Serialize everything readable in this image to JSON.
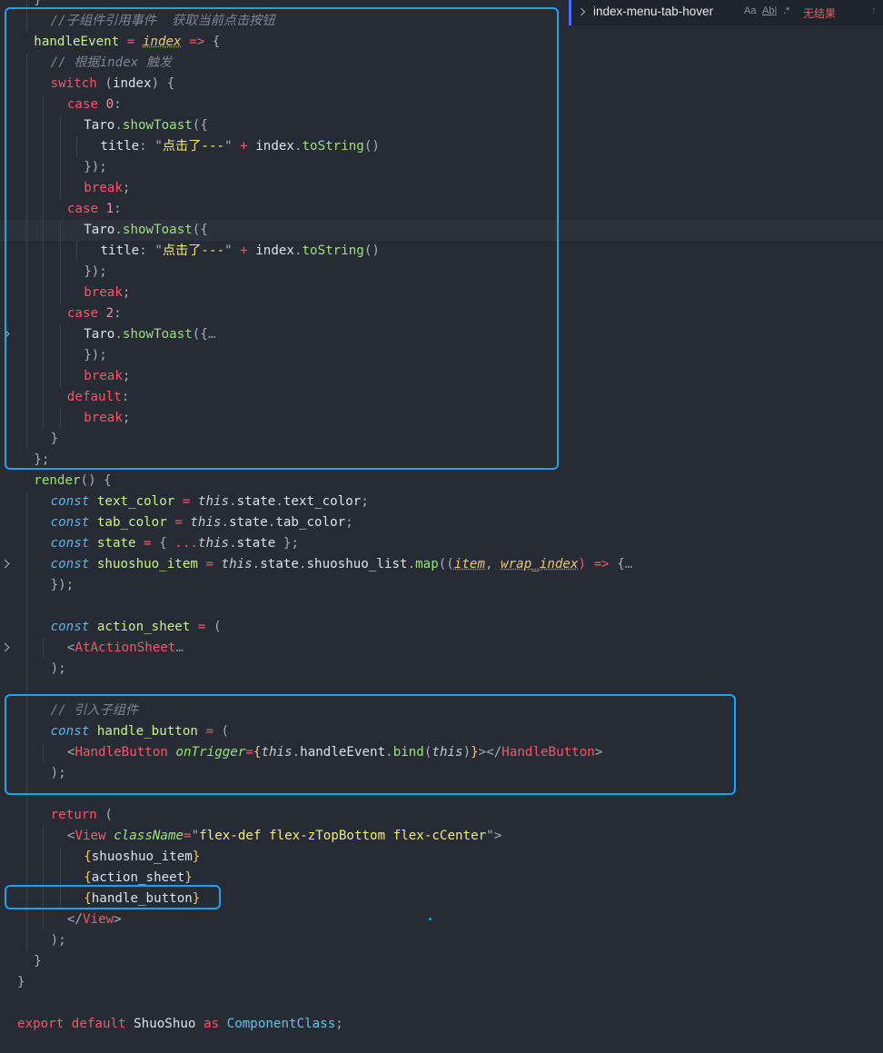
{
  "find_widget": {
    "query": "index-menu-tab-hover",
    "match_case": "Aa",
    "whole_word": "Ab|",
    "regex": ".*",
    "result": "无结果",
    "prev_arrow": "↑"
  },
  "lines": [
    {
      "indent": 1,
      "guides": [
        1
      ],
      "tokens": [
        {
          "t": "}",
          "c": "punct"
        }
      ]
    },
    {
      "indent": 2,
      "guides": [
        1
      ],
      "tokens": [
        {
          "t": "//子组件引用事件  获取当前点击按钮",
          "c": "comment"
        }
      ]
    },
    {
      "indent": 1,
      "guides": [],
      "tokens": [
        {
          "t": "handleEvent",
          "c": "var"
        },
        {
          "t": " = ",
          "c": "op"
        },
        {
          "t": "index",
          "c": "param"
        },
        {
          "t": " => ",
          "c": "op"
        },
        {
          "t": "{",
          "c": "punct"
        }
      ]
    },
    {
      "indent": 2,
      "guides": [
        1
      ],
      "tokens": [
        {
          "t": "// 根据index 触发",
          "c": "comment"
        }
      ]
    },
    {
      "indent": 2,
      "guides": [
        1
      ],
      "tokens": [
        {
          "t": "switch",
          "c": "kw"
        },
        {
          "t": " (",
          "c": "punct"
        },
        {
          "t": "index",
          "c": "plain"
        },
        {
          "t": ") {",
          "c": "punct"
        }
      ]
    },
    {
      "indent": 3,
      "guides": [
        1,
        2
      ],
      "tokens": [
        {
          "t": "case",
          "c": "kw"
        },
        {
          "t": " ",
          "c": "plain"
        },
        {
          "t": "0",
          "c": "num"
        },
        {
          "t": ":",
          "c": "punct"
        }
      ]
    },
    {
      "indent": 4,
      "guides": [
        1,
        2,
        3
      ],
      "tokens": [
        {
          "t": "Taro",
          "c": "plain"
        },
        {
          "t": ".",
          "c": "punct"
        },
        {
          "t": "showToast",
          "c": "fn"
        },
        {
          "t": "({",
          "c": "punct"
        }
      ]
    },
    {
      "indent": 5,
      "guides": [
        1,
        2,
        3,
        4
      ],
      "tokens": [
        {
          "t": "title",
          "c": "prop"
        },
        {
          "t": ": ",
          "c": "punct"
        },
        {
          "t": "\"",
          "c": "punct"
        },
        {
          "t": "点击了---",
          "c": "str"
        },
        {
          "t": "\"",
          "c": "punct"
        },
        {
          "t": " + ",
          "c": "op"
        },
        {
          "t": "index",
          "c": "plain"
        },
        {
          "t": ".",
          "c": "punct"
        },
        {
          "t": "toString",
          "c": "fn"
        },
        {
          "t": "()",
          "c": "punct"
        }
      ]
    },
    {
      "indent": 4,
      "guides": [
        1,
        2,
        3
      ],
      "tokens": [
        {
          "t": "});",
          "c": "punct"
        }
      ]
    },
    {
      "indent": 4,
      "guides": [
        1,
        2,
        3
      ],
      "tokens": [
        {
          "t": "break",
          "c": "kw"
        },
        {
          "t": ";",
          "c": "punct"
        }
      ]
    },
    {
      "indent": 3,
      "guides": [
        1,
        2
      ],
      "tokens": [
        {
          "t": "case",
          "c": "kw"
        },
        {
          "t": " ",
          "c": "plain"
        },
        {
          "t": "1",
          "c": "num"
        },
        {
          "t": ":",
          "c": "punct"
        }
      ]
    },
    {
      "indent": 4,
      "guides": [
        1,
        2,
        3
      ],
      "active": true,
      "tokens": [
        {
          "t": "Taro",
          "c": "plain"
        },
        {
          "t": ".",
          "c": "punct"
        },
        {
          "t": "showToast",
          "c": "fn"
        },
        {
          "t": "({",
          "c": "punct"
        }
      ]
    },
    {
      "indent": 5,
      "guides": [
        1,
        2,
        3,
        4
      ],
      "tokens": [
        {
          "t": "title",
          "c": "prop"
        },
        {
          "t": ": ",
          "c": "punct"
        },
        {
          "t": "\"",
          "c": "punct"
        },
        {
          "t": "点击了---",
          "c": "str"
        },
        {
          "t": "\"",
          "c": "punct"
        },
        {
          "t": " + ",
          "c": "op"
        },
        {
          "t": "index",
          "c": "plain"
        },
        {
          "t": ".",
          "c": "punct"
        },
        {
          "t": "toString",
          "c": "fn"
        },
        {
          "t": "()",
          "c": "punct"
        }
      ]
    },
    {
      "indent": 4,
      "guides": [
        1,
        2,
        3
      ],
      "tokens": [
        {
          "t": "});",
          "c": "punct"
        }
      ]
    },
    {
      "indent": 4,
      "guides": [
        1,
        2,
        3
      ],
      "tokens": [
        {
          "t": "break",
          "c": "kw"
        },
        {
          "t": ";",
          "c": "punct"
        }
      ]
    },
    {
      "indent": 3,
      "guides": [
        1,
        2
      ],
      "tokens": [
        {
          "t": "case",
          "c": "kw"
        },
        {
          "t": " ",
          "c": "plain"
        },
        {
          "t": "2",
          "c": "num"
        },
        {
          "t": ":",
          "c": "punct"
        }
      ]
    },
    {
      "indent": 4,
      "guides": [
        1,
        2,
        3
      ],
      "fold": true,
      "tokens": [
        {
          "t": "Taro",
          "c": "plain"
        },
        {
          "t": ".",
          "c": "punct"
        },
        {
          "t": "showToast",
          "c": "fn"
        },
        {
          "t": "({",
          "c": "punct"
        },
        {
          "t": "…",
          "c": "ell"
        }
      ]
    },
    {
      "indent": 4,
      "guides": [
        1,
        2,
        3
      ],
      "tokens": [
        {
          "t": "});",
          "c": "punct"
        }
      ]
    },
    {
      "indent": 4,
      "guides": [
        1,
        2,
        3
      ],
      "tokens": [
        {
          "t": "break",
          "c": "kw"
        },
        {
          "t": ";",
          "c": "punct"
        }
      ]
    },
    {
      "indent": 3,
      "guides": [
        1,
        2
      ],
      "tokens": [
        {
          "t": "default",
          "c": "kw"
        },
        {
          "t": ":",
          "c": "punct"
        }
      ]
    },
    {
      "indent": 4,
      "guides": [
        1,
        2,
        3
      ],
      "tokens": [
        {
          "t": "break",
          "c": "kw"
        },
        {
          "t": ";",
          "c": "punct"
        }
      ]
    },
    {
      "indent": 2,
      "guides": [
        1
      ],
      "tokens": [
        {
          "t": "}",
          "c": "punct"
        }
      ]
    },
    {
      "indent": 1,
      "guides": [],
      "tokens": [
        {
          "t": "};",
          "c": "punct"
        }
      ]
    },
    {
      "indent": 1,
      "guides": [],
      "tokens": [
        {
          "t": "render",
          "c": "fn"
        },
        {
          "t": "() {",
          "c": "punct"
        }
      ]
    },
    {
      "indent": 2,
      "guides": [
        1
      ],
      "tokens": [
        {
          "t": "const",
          "c": "storage"
        },
        {
          "t": " ",
          "c": "plain"
        },
        {
          "t": "text_color",
          "c": "var"
        },
        {
          "t": " = ",
          "c": "op"
        },
        {
          "t": "this",
          "c": "this"
        },
        {
          "t": ".",
          "c": "punct"
        },
        {
          "t": "state",
          "c": "plain"
        },
        {
          "t": ".",
          "c": "punct"
        },
        {
          "t": "text_color",
          "c": "plain"
        },
        {
          "t": ";",
          "c": "punct"
        }
      ]
    },
    {
      "indent": 2,
      "guides": [
        1
      ],
      "tokens": [
        {
          "t": "const",
          "c": "storage"
        },
        {
          "t": " ",
          "c": "plain"
        },
        {
          "t": "tab_color",
          "c": "var"
        },
        {
          "t": " = ",
          "c": "op"
        },
        {
          "t": "this",
          "c": "this"
        },
        {
          "t": ".",
          "c": "punct"
        },
        {
          "t": "state",
          "c": "plain"
        },
        {
          "t": ".",
          "c": "punct"
        },
        {
          "t": "tab_color",
          "c": "plain"
        },
        {
          "t": ";",
          "c": "punct"
        }
      ]
    },
    {
      "indent": 2,
      "guides": [
        1
      ],
      "tokens": [
        {
          "t": "const",
          "c": "storage"
        },
        {
          "t": " ",
          "c": "plain"
        },
        {
          "t": "state",
          "c": "var"
        },
        {
          "t": " = ",
          "c": "op"
        },
        {
          "t": "{ ",
          "c": "punct"
        },
        {
          "t": "...",
          "c": "op"
        },
        {
          "t": "this",
          "c": "this"
        },
        {
          "t": ".",
          "c": "punct"
        },
        {
          "t": "state",
          "c": "plain"
        },
        {
          "t": " };",
          "c": "punct"
        }
      ]
    },
    {
      "indent": 2,
      "guides": [
        1
      ],
      "fold": true,
      "tokens": [
        {
          "t": "const",
          "c": "storage"
        },
        {
          "t": " ",
          "c": "plain"
        },
        {
          "t": "shuoshuo_item",
          "c": "var"
        },
        {
          "t": " = ",
          "c": "op"
        },
        {
          "t": "this",
          "c": "this"
        },
        {
          "t": ".",
          "c": "punct"
        },
        {
          "t": "state",
          "c": "plain"
        },
        {
          "t": ".",
          "c": "punct"
        },
        {
          "t": "shuoshuo_list",
          "c": "plain"
        },
        {
          "t": ".",
          "c": "punct"
        },
        {
          "t": "map",
          "c": "fn"
        },
        {
          "t": "((",
          "c": "punct"
        },
        {
          "t": "item",
          "c": "param"
        },
        {
          "t": ", ",
          "c": "punct"
        },
        {
          "t": "wrap_index",
          "c": "param"
        },
        {
          "t": ") => ",
          "c": "op"
        },
        {
          "t": "{",
          "c": "punct"
        },
        {
          "t": "…",
          "c": "ell"
        }
      ]
    },
    {
      "indent": 2,
      "guides": [
        1
      ],
      "tokens": [
        {
          "t": "});",
          "c": "punct"
        }
      ]
    },
    {
      "indent": 0,
      "guides": [
        1
      ],
      "tokens": []
    },
    {
      "indent": 2,
      "guides": [
        1
      ],
      "tokens": [
        {
          "t": "const",
          "c": "storage"
        },
        {
          "t": " ",
          "c": "plain"
        },
        {
          "t": "action_sheet",
          "c": "var"
        },
        {
          "t": " = ",
          "c": "op"
        },
        {
          "t": "(",
          "c": "punct"
        }
      ]
    },
    {
      "indent": 3,
      "guides": [
        1,
        2
      ],
      "fold": true,
      "tokens": [
        {
          "t": "<",
          "c": "punct"
        },
        {
          "t": "AtActionSheet",
          "c": "tag"
        },
        {
          "t": "…",
          "c": "ell"
        }
      ]
    },
    {
      "indent": 2,
      "guides": [
        1
      ],
      "tokens": [
        {
          "t": ");",
          "c": "punct"
        }
      ]
    },
    {
      "indent": 0,
      "guides": [
        1
      ],
      "tokens": []
    },
    {
      "indent": 2,
      "guides": [
        1
      ],
      "tokens": [
        {
          "t": "// 引入子组件",
          "c": "comment"
        }
      ]
    },
    {
      "indent": 2,
      "guides": [
        1
      ],
      "tokens": [
        {
          "t": "const",
          "c": "storage"
        },
        {
          "t": " ",
          "c": "plain"
        },
        {
          "t": "handle_button",
          "c": "var"
        },
        {
          "t": " = ",
          "c": "op"
        },
        {
          "t": "(",
          "c": "punct"
        }
      ]
    },
    {
      "indent": 3,
      "guides": [
        1,
        2
      ],
      "tokens": [
        {
          "t": "<",
          "c": "punct"
        },
        {
          "t": "HandleButton",
          "c": "tag"
        },
        {
          "t": " ",
          "c": "plain"
        },
        {
          "t": "onTrigger",
          "c": "attr"
        },
        {
          "t": "=",
          "c": "op"
        },
        {
          "t": "{",
          "c": "brace"
        },
        {
          "t": "this",
          "c": "this"
        },
        {
          "t": ".",
          "c": "punct"
        },
        {
          "t": "handleEvent",
          "c": "plain"
        },
        {
          "t": ".",
          "c": "punct"
        },
        {
          "t": "bind",
          "c": "fn"
        },
        {
          "t": "(",
          "c": "punct"
        },
        {
          "t": "this",
          "c": "this"
        },
        {
          "t": ")",
          "c": "punct"
        },
        {
          "t": "}",
          "c": "brace"
        },
        {
          "t": "></",
          "c": "punct"
        },
        {
          "t": "HandleButton",
          "c": "tag"
        },
        {
          "t": ">",
          "c": "punct"
        }
      ]
    },
    {
      "indent": 2,
      "guides": [
        1
      ],
      "tokens": [
        {
          "t": ");",
          "c": "punct"
        }
      ]
    },
    {
      "indent": 0,
      "guides": [
        1
      ],
      "tokens": []
    },
    {
      "indent": 2,
      "guides": [
        1
      ],
      "tokens": [
        {
          "t": "return",
          "c": "kw"
        },
        {
          "t": " (",
          "c": "punct"
        }
      ]
    },
    {
      "indent": 3,
      "guides": [
        1,
        2
      ],
      "tokens": [
        {
          "t": "<",
          "c": "punct"
        },
        {
          "t": "View",
          "c": "tag"
        },
        {
          "t": " ",
          "c": "plain"
        },
        {
          "t": "className",
          "c": "attr"
        },
        {
          "t": "=",
          "c": "op"
        },
        {
          "t": "\"",
          "c": "punct"
        },
        {
          "t": "flex-def flex-zTopBottom flex-cCenter",
          "c": "str"
        },
        {
          "t": "\">",
          "c": "punct"
        }
      ]
    },
    {
      "indent": 4,
      "guides": [
        1,
        2,
        3
      ],
      "tokens": [
        {
          "t": "{",
          "c": "brace"
        },
        {
          "t": "shuoshuo_item",
          "c": "plain"
        },
        {
          "t": "}",
          "c": "brace"
        }
      ]
    },
    {
      "indent": 4,
      "guides": [
        1,
        2,
        3
      ],
      "tokens": [
        {
          "t": "{",
          "c": "brace"
        },
        {
          "t": "action_sheet",
          "c": "plain"
        },
        {
          "t": "}",
          "c": "brace"
        }
      ]
    },
    {
      "indent": 4,
      "guides": [
        1,
        2,
        3
      ],
      "tokens": [
        {
          "t": "{",
          "c": "brace"
        },
        {
          "t": "handle_button",
          "c": "plain"
        },
        {
          "t": "}",
          "c": "brace"
        }
      ]
    },
    {
      "indent": 3,
      "guides": [
        1,
        2
      ],
      "tokens": [
        {
          "t": "</",
          "c": "punct"
        },
        {
          "t": "View",
          "c": "tag"
        },
        {
          "t": ">",
          "c": "punct"
        }
      ]
    },
    {
      "indent": 2,
      "guides": [
        1
      ],
      "tokens": [
        {
          "t": ");",
          "c": "punct"
        }
      ]
    },
    {
      "indent": 1,
      "guides": [],
      "tokens": [
        {
          "t": "}",
          "c": "punct"
        }
      ]
    },
    {
      "indent": 0,
      "guides": [],
      "tokens": [
        {
          "t": "}",
          "c": "punct"
        }
      ]
    },
    {
      "indent": 0,
      "guides": [],
      "tokens": []
    },
    {
      "indent": 0,
      "guides": [],
      "tokens": [
        {
          "t": "export",
          "c": "kw"
        },
        {
          "t": " ",
          "c": "plain"
        },
        {
          "t": "default",
          "c": "kw"
        },
        {
          "t": " ",
          "c": "plain"
        },
        {
          "t": "ShuoShuo",
          "c": "plain"
        },
        {
          "t": " ",
          "c": "plain"
        },
        {
          "t": "as",
          "c": "kw"
        },
        {
          "t": " ",
          "c": "plain"
        },
        {
          "t": "ComponentClass",
          "c": "cls"
        },
        {
          "t": ";",
          "c": "punct"
        }
      ]
    }
  ]
}
